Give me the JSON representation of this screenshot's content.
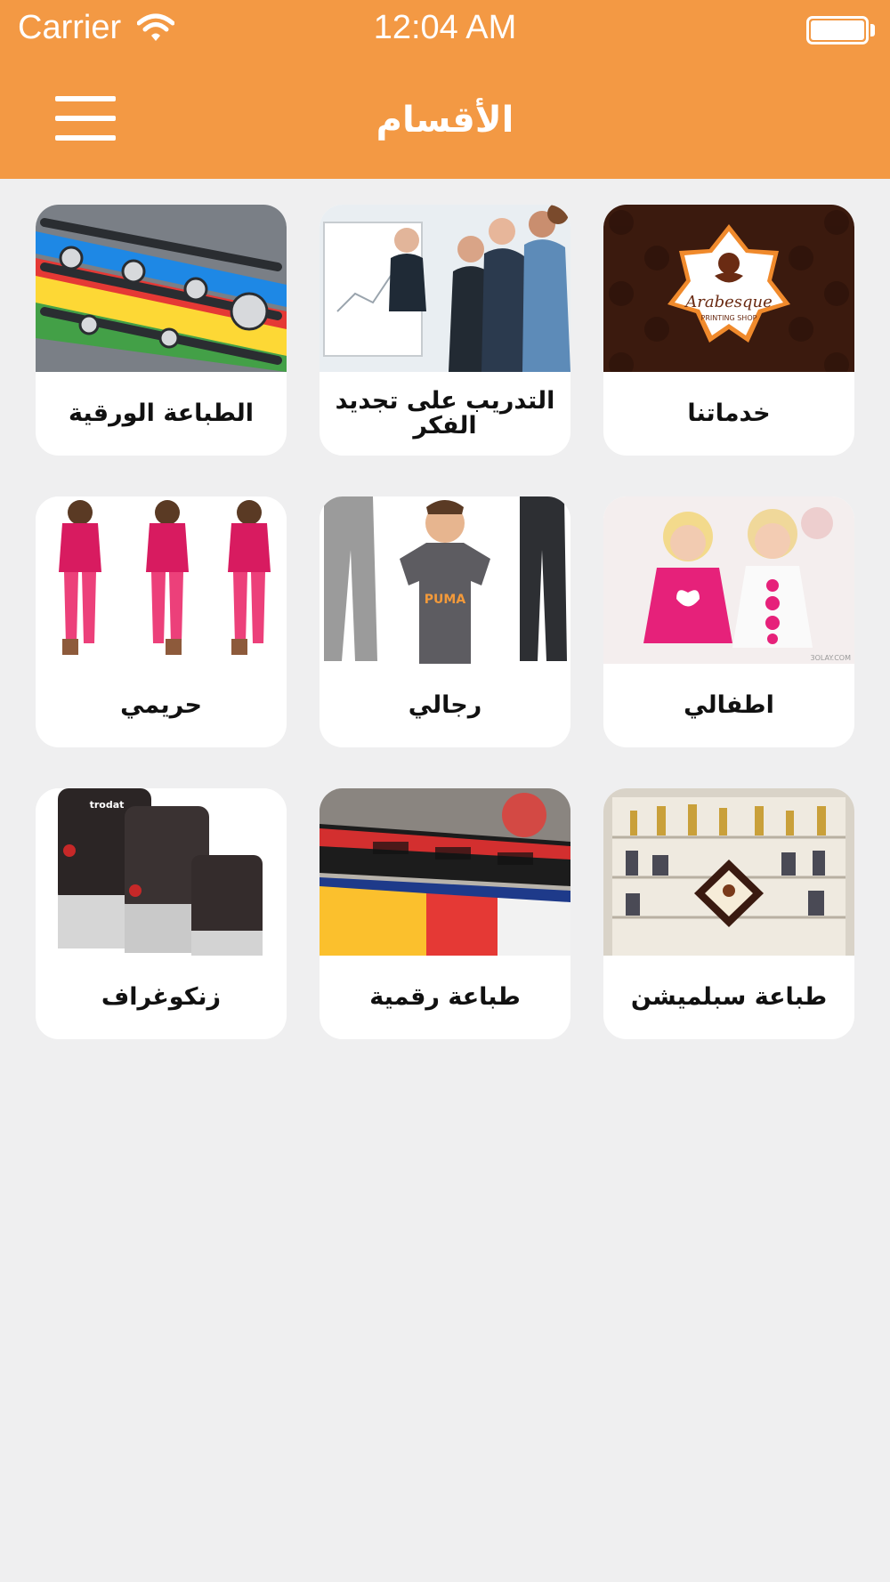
{
  "status_bar": {
    "carrier": "Carrier",
    "time": "12:04 AM"
  },
  "header": {
    "title": "الأقسام",
    "menu_icon": "hamburger-menu-icon",
    "background_color": "#f39944"
  },
  "categories": [
    {
      "label": "خدماتنا",
      "image": "arabesque-logo-image"
    },
    {
      "label": "التدريب على تجديد الفكر",
      "image": "training-presentation-image"
    },
    {
      "label": "الطباعة الورقية",
      "image": "printing-press-image"
    },
    {
      "label": "اطفالي",
      "image": "kids-dresses-image",
      "watermark": "3OLAY.COM"
    },
    {
      "label": "رجالي",
      "image": "mens-clothes-image",
      "brand": "PUMA"
    },
    {
      "label": "حريمي",
      "image": "womens-outfits-image"
    },
    {
      "label": "طباعة سبلميشن",
      "image": "sublimation-shelf-image"
    },
    {
      "label": "طباعة رقمية",
      "image": "digital-printer-image"
    },
    {
      "label": "زنكوغراف",
      "image": "rubber-stamps-image",
      "brand": "trodat"
    }
  ],
  "logo": {
    "line1": "Arabesque",
    "line2": "PRINTING SHOP"
  }
}
